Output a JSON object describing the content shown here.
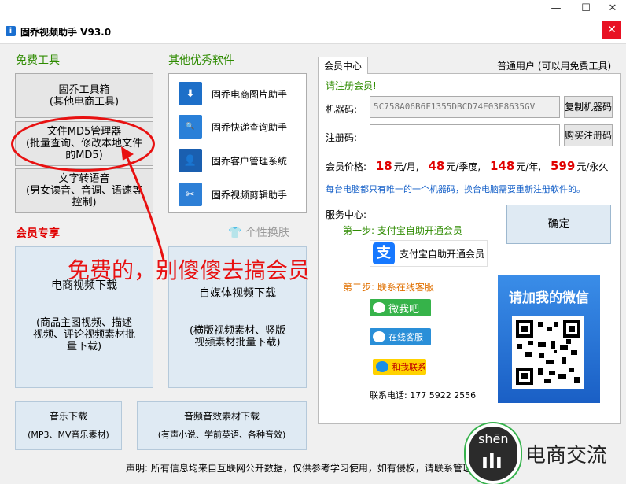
{
  "window": {
    "title": "固乔视频助手 V93.0",
    "minimize": "—",
    "maximize": "☐",
    "close": "✕"
  },
  "sections": {
    "free_tools": "免费工具",
    "other_software": "其他优秀软件",
    "members_only": "会员专享",
    "skin": "个性换肤"
  },
  "free_tools": [
    {
      "line1": "固乔工具箱",
      "line2": "(其他电商工具)"
    },
    {
      "line1": "文件MD5管理器",
      "line2": "(批量查询、修改本地文件",
      "line3": "的MD5)"
    },
    {
      "line1": "文字转语音",
      "line2": "(男女读音、音调、语速等",
      "line3": "控制)"
    }
  ],
  "software": [
    {
      "label": "固乔电商图片助手",
      "icon": "download-icon",
      "color": "#1d6fc8"
    },
    {
      "label": "固乔快递查询助手",
      "icon": "search-express-icon",
      "color": "#2a80d8"
    },
    {
      "label": "固乔客户管理系统",
      "icon": "user-icon",
      "color": "#1a5fb0"
    },
    {
      "label": "固乔视频剪辑助手",
      "icon": "scissors-icon",
      "color": "#2d7fd6"
    }
  ],
  "member_tools": [
    {
      "title": "电商视频下载",
      "desc1": "(商品主图视频、描述",
      "desc2": "视频、评论视频素材批",
      "desc3": "量下载)"
    },
    {
      "title": "自媒体视频下载",
      "desc1": "(横版视频素材、竖版",
      "desc2": "视频素材批量下载)"
    }
  ],
  "bottom_tools": [
    {
      "title": "音乐下载",
      "desc": "(MP3、MV音乐素材)"
    },
    {
      "title": "音频音效素材下载",
      "desc": "(有声小说、学前英语、各种音效)"
    }
  ],
  "member_center": {
    "tab": "会员中心",
    "user_type": "普通用户 (可以用免费工具)",
    "status": "请注册会员!",
    "machine_label": "机器码:",
    "machine_value": "5C758A06B6F1355DBCD74E03F8635GV",
    "copy_button": "复制机器码",
    "reg_label": "注册码:",
    "reg_value": "",
    "buy_button": "购买注册码",
    "price_label": "会员价格:",
    "prices": [
      {
        "num": "18",
        "unit": "元/月,"
      },
      {
        "num": "48",
        "unit": "元/季度,"
      },
      {
        "num": "148",
        "unit": "元/年,"
      },
      {
        "num": "599",
        "unit": "元/永久"
      }
    ],
    "note": "每台电脑都只有唯一的一个机器码，换台电脑需要重新注册软件的。",
    "service_label": "服务中心:",
    "step1": "第一步: 支付宝自助开通会员",
    "alipay_label": "支付宝自助开通会员",
    "step2": "第二步: 联系在线客服",
    "wechat_label": "微我吧",
    "online_label": "在线客服",
    "qq_label": "和我联系",
    "qr_title": "请加我的微信",
    "contact": "联系电话: 177 5922 2556",
    "confirm": "确定"
  },
  "footer": "声明: 所有信息均来自互联网公开数据，仅供参考学习使用，如有侵权，请联系管理员删除",
  "annotation": "免费的，别傻傻去搞会员",
  "watermark": {
    "shen": "shēn",
    "text": "电商交流"
  }
}
